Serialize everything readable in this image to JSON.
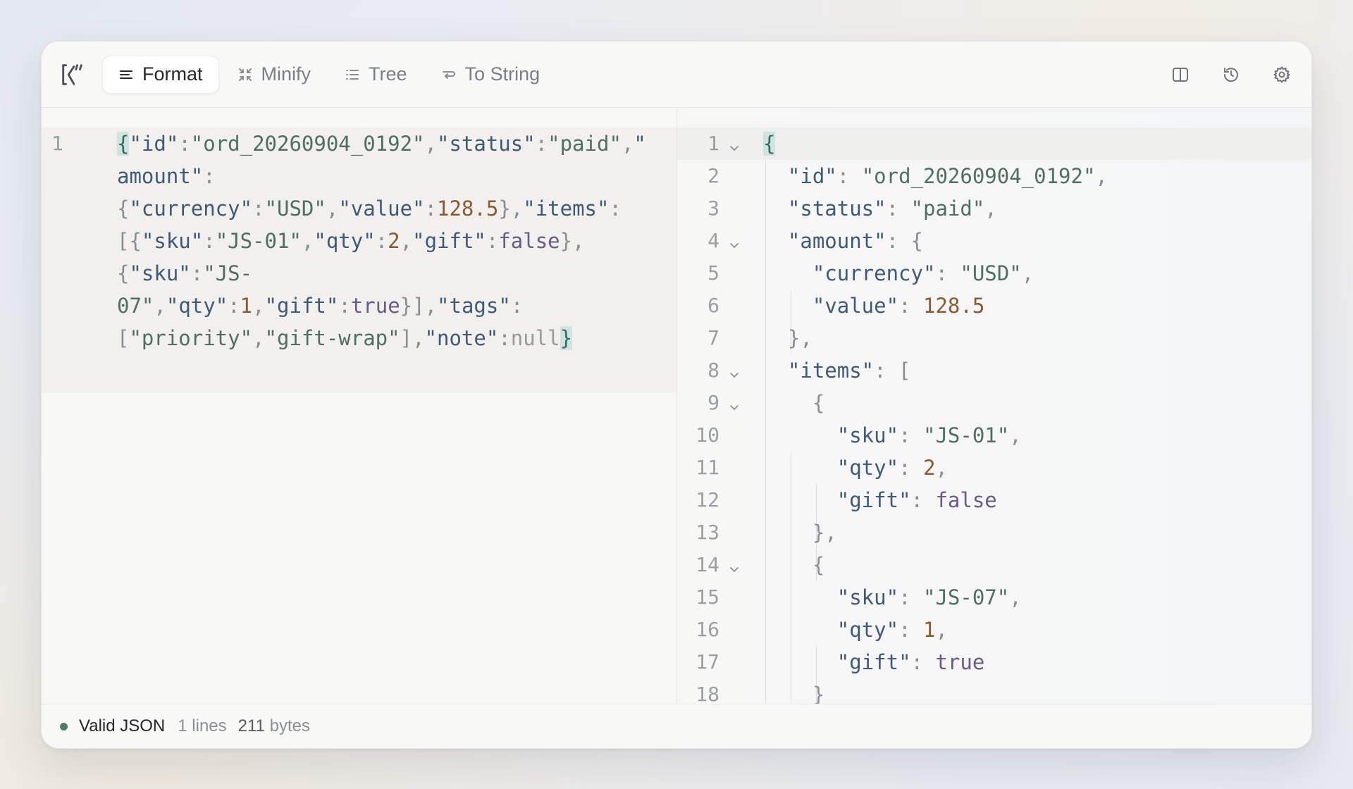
{
  "toolbar": {
    "buttons": [
      {
        "label": "Format",
        "icon": "align-lines-icon",
        "active": true
      },
      {
        "label": "Minify",
        "icon": "shrink-arrows-icon",
        "active": false
      },
      {
        "label": "Tree",
        "icon": "list-tree-icon",
        "active": false
      },
      {
        "label": "To String",
        "icon": "wrap-arrow-icon",
        "active": false
      }
    ],
    "right_icons": [
      "split-view-icon",
      "history-icon",
      "gear-icon"
    ]
  },
  "input": {
    "line_numbers": [
      "1"
    ],
    "lines": [
      "{\"id\":\"ord_20260904_0192\",\"status\":\"paid\",\"",
      "amount\":",
      "{\"currency\":\"USD\",\"value\":128.5},\"items\":",
      "[{\"sku\":\"JS-01\",\"qty\":2,\"gift\":false},",
      "{\"sku\":\"JS-",
      "07\",\"qty\":1,\"gift\":true}],\"tags\":",
      "[\"priority\",\"gift-wrap\"],\"note\":null}"
    ]
  },
  "output": {
    "line_numbers": [
      "1",
      "2",
      "3",
      "4",
      "5",
      "6",
      "7",
      "8",
      "9",
      "10",
      "11",
      "12",
      "13",
      "14",
      "15",
      "16",
      "17",
      "18"
    ],
    "fold_lines": [
      1,
      4,
      8,
      9,
      14
    ],
    "lines": [
      "{",
      "  \"id\": \"ord_20260904_0192\",",
      "  \"status\": \"paid\",",
      "  \"amount\": {",
      "    \"currency\": \"USD\",",
      "    \"value\": 128.5",
      "  },",
      "  \"items\": [",
      "    {",
      "      \"sku\": \"JS-01\",",
      "      \"qty\": 2,",
      "      \"gift\": false",
      "    },",
      "    {",
      "      \"sku\": \"JS-07\",",
      "      \"qty\": 1,",
      "      \"gift\": true",
      "    }"
    ]
  },
  "status": {
    "valid_label": "Valid JSON",
    "lines_count": "1",
    "lines_label": "lines",
    "bytes_count": "211",
    "bytes_label": "bytes"
  },
  "colors": {
    "key": "#3f5a78",
    "string": "#4f7060",
    "number": "#8a5a32",
    "boolean": "#6a5a8a",
    "null": "#9a9a9a",
    "valid_dot": "#4f7a63"
  }
}
